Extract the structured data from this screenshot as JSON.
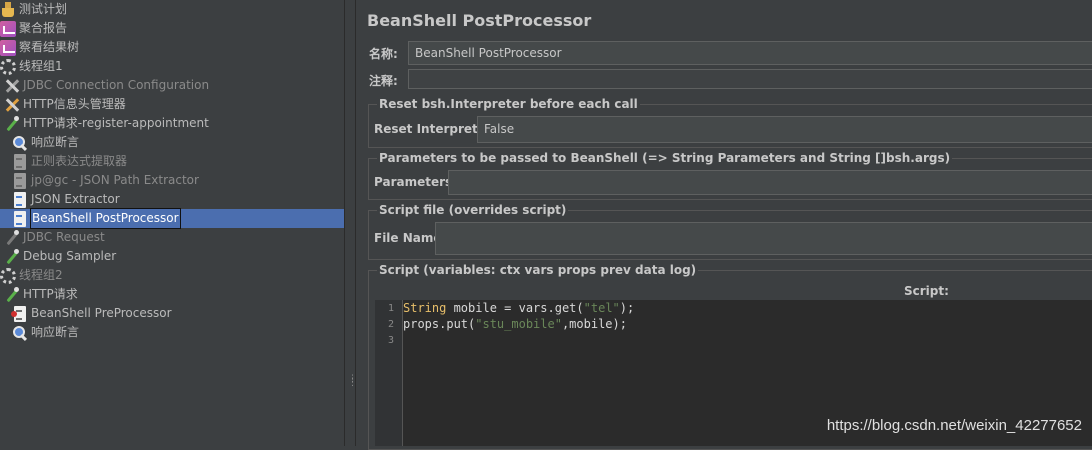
{
  "tree": {
    "items": [
      {
        "label": "测试计划"
      },
      {
        "label": "聚合报告"
      },
      {
        "label": "察看结果树"
      },
      {
        "label": "线程组1"
      },
      {
        "label": "JDBC Connection Configuration"
      },
      {
        "label": "HTTP信息头管理器"
      },
      {
        "label": "HTTP请求-register-appointment"
      },
      {
        "label": "响应断言"
      },
      {
        "label": "正则表达式提取器"
      },
      {
        "label": "jp@gc - JSON Path Extractor"
      },
      {
        "label": "JSON Extractor"
      },
      {
        "label": "BeanShell PostProcessor"
      },
      {
        "label": "JDBC Request"
      },
      {
        "label": "Debug Sampler"
      },
      {
        "label": "线程组2"
      },
      {
        "label": "HTTP请求"
      },
      {
        "label": "BeanShell PreProcessor"
      },
      {
        "label": "响应断言"
      }
    ]
  },
  "panel": {
    "title": "BeanShell PostProcessor",
    "name_label": "名称:",
    "name_value": "BeanShell PostProcessor",
    "comment_label": "注释:",
    "comment_value": "",
    "reset_group": "Reset bsh.Interpreter before each call",
    "reset_label": "Reset Interpreter:",
    "reset_value": "False",
    "params_group": "Parameters to be passed to BeanShell (=> String Parameters and String []bsh.args)",
    "params_label": "Parameters:",
    "params_value": "",
    "file_group": "Script file (overrides script)",
    "file_label": "File Name:",
    "file_value": "",
    "script_group": "Script (variables: ctx vars props prev data log)",
    "script_label": "Script:"
  },
  "editor": {
    "line_numbers": [
      "1",
      "2",
      "3"
    ],
    "line1": {
      "kw": "String",
      "a": " mobile = vars.get(",
      "s": "\"tel\"",
      "b": ");"
    },
    "line2": {
      "a": "props.put(",
      "s": "\"stu_mobile\"",
      "b": ",mobile);"
    }
  },
  "watermark": "https://blog.csdn.net/weixin_42277652"
}
